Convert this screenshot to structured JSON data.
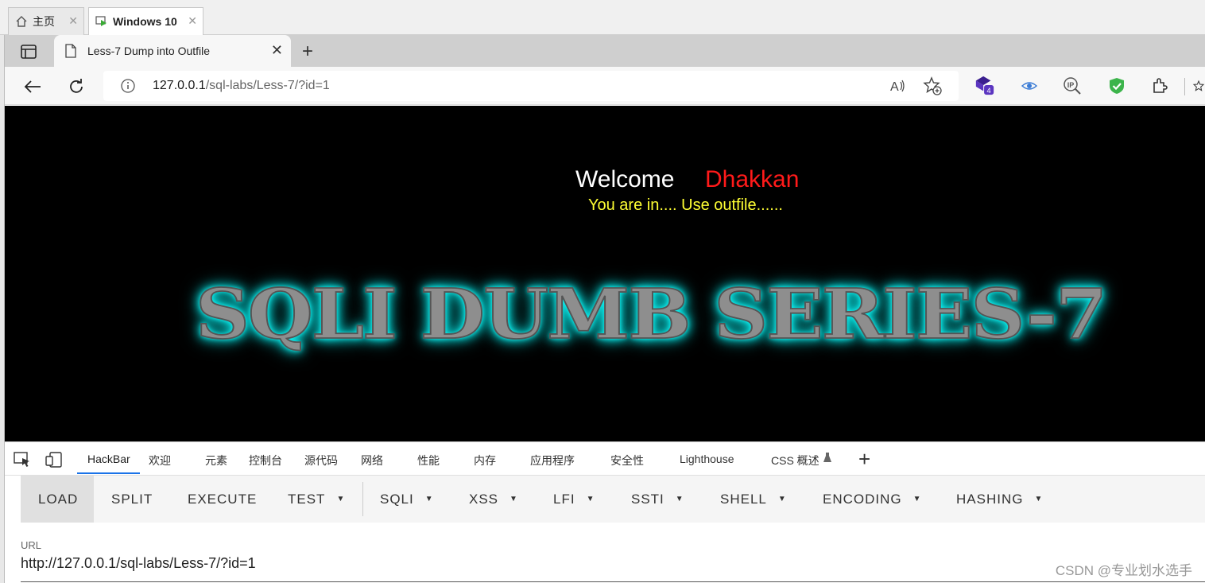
{
  "vm": {
    "tabs": [
      {
        "label": "主页"
      },
      {
        "label": "Windows 10"
      }
    ]
  },
  "browser": {
    "tab_title": "Less-7 Dump into Outfile",
    "url_host": "127.0.0.1",
    "url_path": "/sql-labs/Less-7/?id=1",
    "extension_badge": "4"
  },
  "page": {
    "welcome": "Welcome",
    "name": "Dhakkan",
    "status": "You are in.... Use outfile......",
    "banner": "SQLI DUMB SERIES-7",
    "colors": {
      "background": "#000000",
      "name": "#ff1a1a",
      "status": "#ffff33",
      "glow": "#11eeee"
    }
  },
  "devtools": {
    "tabs": [
      "HackBar",
      "欢迎",
      "元素",
      "控制台",
      "源代码",
      "网络",
      "性能",
      "内存",
      "应用程序",
      "安全性",
      "Lighthouse",
      "CSS 概述"
    ],
    "active_tab": "HackBar"
  },
  "hackbar": {
    "buttons": [
      "LOAD",
      "SPLIT",
      "EXECUTE",
      "TEST",
      "SQLI",
      "XSS",
      "LFI",
      "SSTI",
      "SHELL",
      "ENCODING",
      "HASHING"
    ],
    "url_label": "URL",
    "url_value": "http://127.0.0.1/sql-labs/Less-7/?id=1"
  },
  "watermark": "CSDN @专业划水选手"
}
